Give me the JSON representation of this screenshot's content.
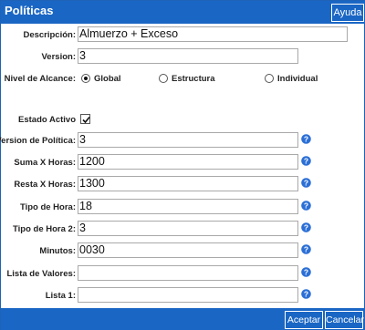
{
  "window": {
    "title": "Políticas",
    "help_label": "Ayuda"
  },
  "form": {
    "descripcion": {
      "label": "Descripción:",
      "value": "Almuerzo + Exceso"
    },
    "version": {
      "label": "Version:",
      "value": "3"
    },
    "nivel_alcance": {
      "label": "Nivel de Alcance:",
      "options": [
        {
          "label": "Global",
          "selected": true
        },
        {
          "label": "Estructura",
          "selected": false
        },
        {
          "label": "Individual",
          "selected": false
        }
      ]
    },
    "estado_activo": {
      "label": "Estado Activo",
      "checked": true
    },
    "version_politica": {
      "label": "Version de Política:",
      "value": "3"
    },
    "suma_x_horas": {
      "label": "Suma X Horas:",
      "value": "1200"
    },
    "resta_x_horas": {
      "label": "Resta X Horas:",
      "value": "1300"
    },
    "tipo_hora": {
      "label": "Tipo de Hora:",
      "value": "18"
    },
    "tipo_hora_2": {
      "label": "Tipo de Hora 2:",
      "value": "3"
    },
    "minutos": {
      "label": "Minutos:",
      "value": "0030"
    },
    "lista_valores": {
      "label": "Lista de Valores:",
      "value": ""
    },
    "lista_1": {
      "label": "Lista 1:",
      "value": ""
    }
  },
  "footer": {
    "accept_label": "Aceptar",
    "cancel_label": "Cancelar"
  },
  "icons": {
    "info": "help-info-icon"
  },
  "colors": {
    "titlebar": "#1a66c4",
    "info_icon": "#2b6fd6"
  }
}
